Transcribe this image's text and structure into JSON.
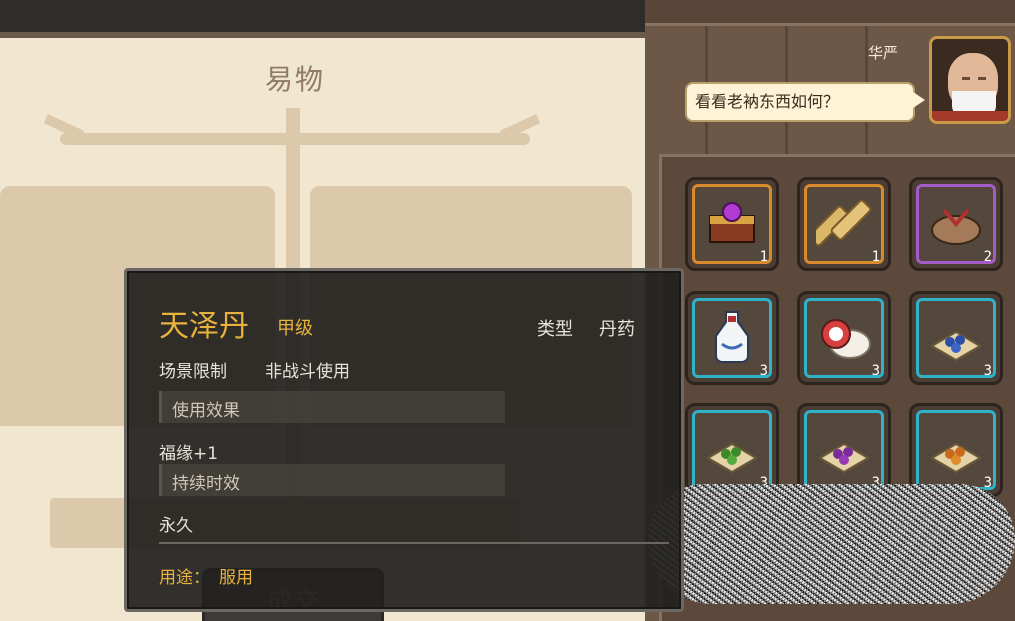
{
  "trade_panel": {
    "title": "易物",
    "confirm_label": "成交"
  },
  "merchant": {
    "name": "华严",
    "dialogue": "看看老衲东西如何？"
  },
  "inventory": [
    {
      "icon": "treasure-chest-icon",
      "count": "1",
      "rarity_color": "#d98a2b"
    },
    {
      "icon": "bamboo-scroll-icon",
      "count": "1",
      "rarity_color": "#d98a2b"
    },
    {
      "icon": "cloth-bundle-icon",
      "count": "2",
      "rarity_color": "#a55cc9"
    },
    {
      "icon": "medicine-bottle-icon",
      "count": "3",
      "rarity_color": "#2fb3c9"
    },
    {
      "icon": "cake-plate-icon",
      "count": "3",
      "rarity_color": "#2fb3c9"
    },
    {
      "icon": "blue-pills-icon",
      "count": "3",
      "rarity_color": "#2fb3c9"
    },
    {
      "icon": "green-pills-icon",
      "count": "3",
      "rarity_color": "#2fb3c9"
    },
    {
      "icon": "purple-pills-icon",
      "count": "3",
      "rarity_color": "#2fb3c9"
    },
    {
      "icon": "orange-pills-icon",
      "count": "3",
      "rarity_color": "#2fb3c9"
    }
  ],
  "tooltip": {
    "name": "天泽丹",
    "grade": "甲级",
    "type_label": "类型",
    "type_value": "丹药",
    "scene_label": "场景限制",
    "scene_value": "非战斗使用",
    "effect_header": "使用效果",
    "effect_value": "福缘+1",
    "duration_header": "持续时效",
    "duration_value": "永久",
    "usage_label": "用途：",
    "usage_value": "服用"
  },
  "colors": {
    "gold": "#e7b23d",
    "parchment": "#f1e6cf",
    "wood": "#6d5747"
  }
}
